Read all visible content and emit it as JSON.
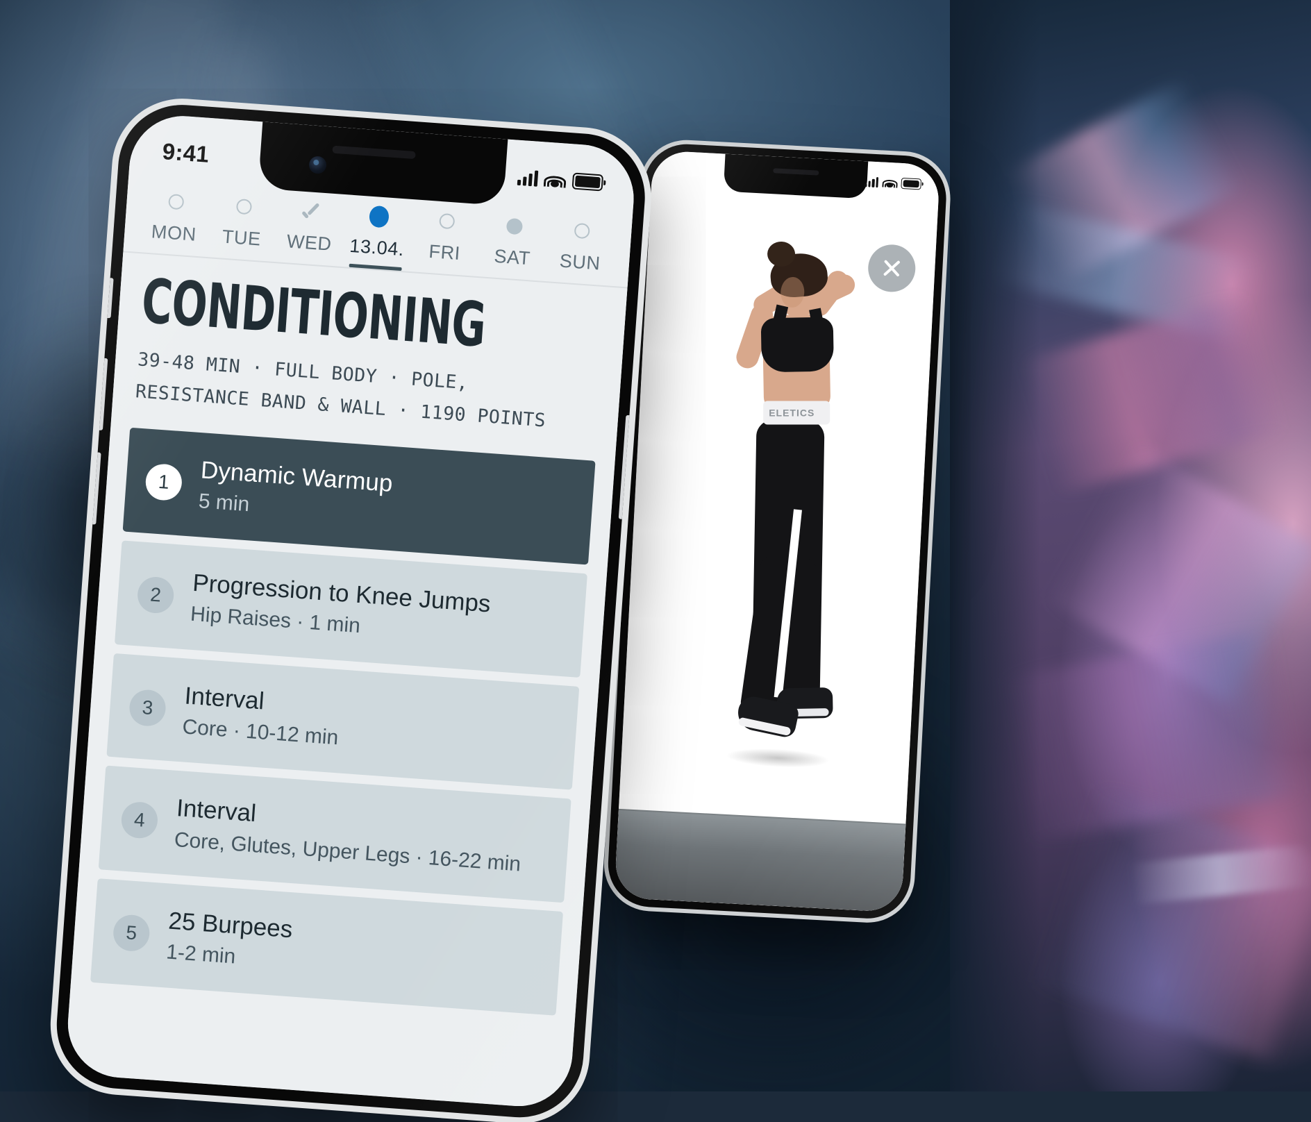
{
  "background": {
    "description": "blurred dark blue studio backdrop with iridescent pink foil fabric on right"
  },
  "front_phone": {
    "status_bar": {
      "time": "9:41",
      "signal_icon": "cellular-bars-icon",
      "wifi_icon": "wifi-icon",
      "battery_icon": "battery-full-icon"
    },
    "day_selector": [
      {
        "label": "MON",
        "indicator": "ring-empty",
        "active": false
      },
      {
        "label": "TUE",
        "indicator": "ring-empty",
        "active": false
      },
      {
        "label": "WED",
        "indicator": "check-icon",
        "active": false
      },
      {
        "label": "13.04.",
        "indicator": "dot-active",
        "active": true
      },
      {
        "label": "FRI",
        "indicator": "ring-empty",
        "active": false
      },
      {
        "label": "SAT",
        "indicator": "dot-filled",
        "active": false
      },
      {
        "label": "SUN",
        "indicator": "ring-empty",
        "active": false
      }
    ],
    "workout": {
      "title": "CONDITIONING",
      "meta": "39-48 MIN · FULL BODY · POLE, RESISTANCE BAND & WALL · 1190 POINTS",
      "duration": "39-48 MIN",
      "body_area": "FULL BODY",
      "equipment": "POLE, RESISTANCE BAND & WALL",
      "points": "1190 POINTS"
    },
    "exercises": [
      {
        "number": "1",
        "title": "Dynamic Warmup",
        "subtitle": "5 min",
        "highlighted": true
      },
      {
        "number": "2",
        "title": "Progression to Knee Jumps",
        "subtitle": "Hip Raises · 1 min",
        "highlighted": false
      },
      {
        "number": "3",
        "title": "Interval",
        "subtitle": "Core · 10-12 min",
        "highlighted": false
      },
      {
        "number": "4",
        "title": "Interval",
        "subtitle": "Core, Glutes, Upper Legs · 16-22 min",
        "highlighted": false
      },
      {
        "number": "5",
        "title": "25 Burpees",
        "subtitle": "1-2 min",
        "highlighted": false
      }
    ]
  },
  "back_phone": {
    "status_bar": {
      "signal_icon": "cellular-bars-icon",
      "wifi_icon": "wifi-icon",
      "battery_icon": "battery-full-icon"
    },
    "close_button": {
      "icon": "close-icon",
      "label": ""
    },
    "video": {
      "description": "athlete performing a knee jump on white studio background"
    }
  },
  "colors": {
    "accent_blue": "#0f74c4",
    "card_dark": "#3b4d56",
    "card_light": "#cfd9dd",
    "screen_bg": "#eceff1",
    "text_dark": "#1e2a31",
    "text_muted": "#5e6e78"
  }
}
